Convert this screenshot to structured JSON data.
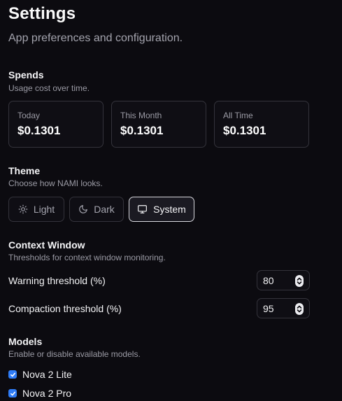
{
  "header": {
    "title": "Settings",
    "subtitle": "App preferences and configuration."
  },
  "spends": {
    "title": "Spends",
    "description": "Usage cost over time.",
    "cards": [
      {
        "label": "Today",
        "value": "$0.1301"
      },
      {
        "label": "This Month",
        "value": "$0.1301"
      },
      {
        "label": "All Time",
        "value": "$0.1301"
      }
    ]
  },
  "theme": {
    "title": "Theme",
    "description": "Choose how NAMI looks.",
    "options": [
      {
        "label": "Light",
        "icon": "sun-icon"
      },
      {
        "label": "Dark",
        "icon": "moon-icon"
      },
      {
        "label": "System",
        "icon": "monitor-icon"
      }
    ],
    "selected": "System"
  },
  "context_window": {
    "title": "Context Window",
    "description": "Thresholds for context window monitoring.",
    "warning": {
      "label": "Warning threshold (%)",
      "value": "80"
    },
    "compaction": {
      "label": "Compaction threshold (%)",
      "value": "95"
    }
  },
  "models": {
    "title": "Models",
    "description": "Enable or disable available models.",
    "items": [
      {
        "label": "Nova 2 Lite",
        "checked": true
      },
      {
        "label": "Nova 2 Pro",
        "checked": true
      }
    ]
  },
  "colors": {
    "background": "#0c0b10",
    "checkbox_accent": "#2f7cf6",
    "border": "#34333b"
  }
}
